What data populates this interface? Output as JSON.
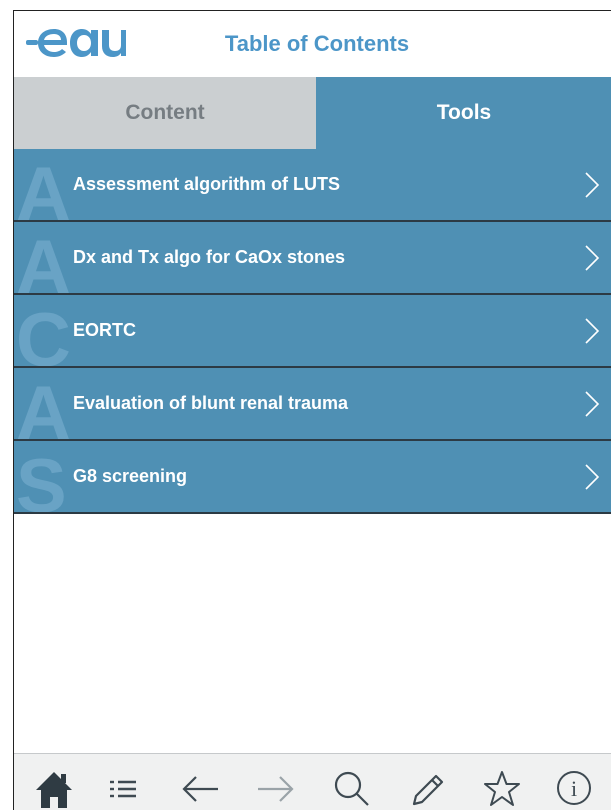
{
  "header": {
    "logo_text": "eau",
    "title": "Table of Contents"
  },
  "tabs": [
    {
      "label": "Content",
      "active": false
    },
    {
      "label": "Tools",
      "active": true
    }
  ],
  "list": {
    "items": [
      {
        "letter": "A",
        "label": "Assessment algorithm of LUTS"
      },
      {
        "letter": "A",
        "label": "Dx and Tx algo for CaOx stones"
      },
      {
        "letter": "C",
        "label": "EORTC"
      },
      {
        "letter": "A",
        "label": "Evaluation of blunt renal trauma"
      },
      {
        "letter": "S",
        "label": "G8 screening"
      }
    ]
  },
  "toolbar": {
    "buttons": [
      {
        "icon": "home-icon",
        "active": true
      },
      {
        "icon": "toc-list-icon"
      },
      {
        "icon": "back-arrow-icon"
      },
      {
        "icon": "forward-arrow-icon",
        "disabled": true
      },
      {
        "icon": "search-icon"
      },
      {
        "icon": "pencil-icon"
      },
      {
        "icon": "star-icon"
      },
      {
        "icon": "info-icon"
      }
    ]
  },
  "colors": {
    "brand": "#4c96c8",
    "row_bg": "#4f90b4",
    "tab_inactive_bg": "#cbcfd1",
    "tab_inactive_text": "#767d82",
    "toolbar_icon": "#3e4a52",
    "toolbar_icon_disabled": "#9aa3a8"
  }
}
